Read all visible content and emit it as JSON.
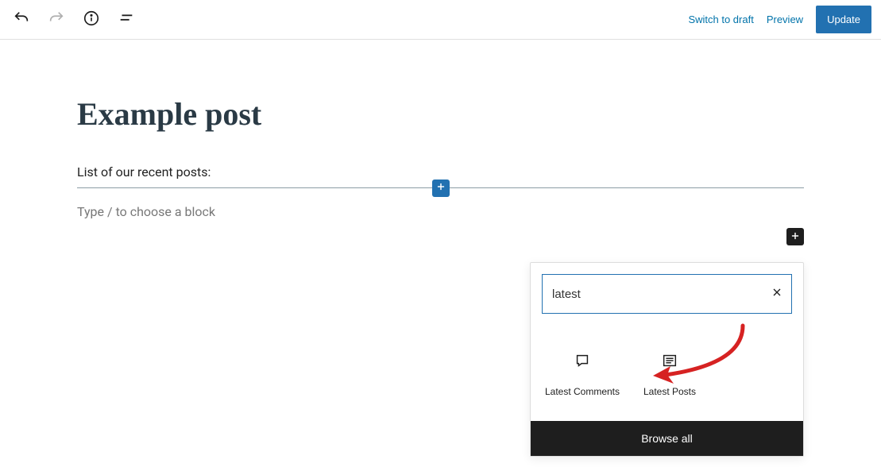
{
  "toolbar": {
    "switch_draft_label": "Switch to draft",
    "preview_label": "Preview",
    "update_label": "Update"
  },
  "editor": {
    "post_title": "Example post",
    "paragraph_text": "List of our recent posts:",
    "block_placeholder": "Type / to choose a block"
  },
  "inserter": {
    "search_value": "latest",
    "blocks": [
      {
        "label": "Latest Comments"
      },
      {
        "label": "Latest Posts"
      }
    ],
    "browse_all_label": "Browse all"
  }
}
